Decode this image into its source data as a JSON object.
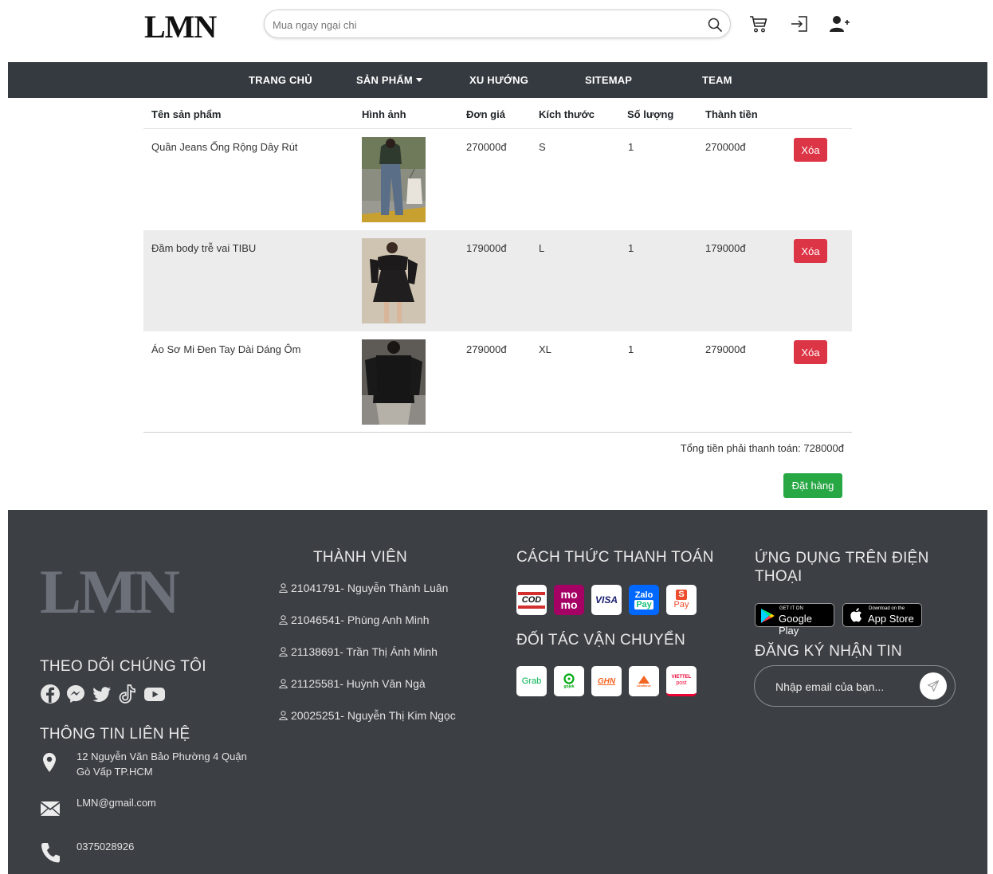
{
  "header": {
    "logo": "LMN",
    "search_placeholder": "Mua ngay ngại chi"
  },
  "nav": {
    "items": [
      "TRANG CHỦ",
      "SẢN PHẨM",
      "XU HƯỚNG",
      "SITEMAP",
      "TEAM"
    ]
  },
  "cart": {
    "columns": [
      "Tên sản phẩm",
      "Hình ảnh",
      "Đơn giá",
      "Kích thước",
      "Số lượng",
      "Thành tiền"
    ],
    "rows": [
      {
        "name": "Quần Jeans Ống Rộng Dây Rút",
        "price": "270000đ",
        "size": "S",
        "qty": "1",
        "subtotal": "270000đ",
        "delete": "Xóa"
      },
      {
        "name": "Đầm body trễ vai TIBU",
        "price": "179000đ",
        "size": "L",
        "qty": "1",
        "subtotal": "179000đ",
        "delete": "Xóa"
      },
      {
        "name": "Áo Sơ Mi Đen Tay Dài Dáng Ôm",
        "price": "279000đ",
        "size": "XL",
        "qty": "1",
        "subtotal": "279000đ",
        "delete": "Xóa"
      }
    ],
    "total": "Tổng tiền phải thanh toán: 728000đ",
    "order_button": "Đặt hàng"
  },
  "footer": {
    "logo": "LMN",
    "follow_title": "THEO DÕI CHÚNG TÔI",
    "social_icons": [
      "facebook-icon",
      "messenger-icon",
      "twitter-icon",
      "tiktok-icon",
      "youtube-icon"
    ],
    "contact_title": "THÔNG TIN LIÊN HỆ",
    "address": "12 Nguyễn Văn Bảo Phường 4 Quận Gò Vấp TP.HCM",
    "email": "LMN@gmail.com",
    "phone": "0375028926",
    "members_title": "THÀNH VIÊN",
    "members": [
      "21041791- Nguyễn Thành Luân",
      "21046541- Phùng Anh Minh",
      "21138691- Trần Thị Ánh Minh",
      "21125581- Huỳnh Văn Ngà",
      "20025251- Nguyễn Thị Kim Ngọc"
    ],
    "payment_title": "CÁCH THỨC THANH TOÁN",
    "payment_methods": {
      "cod": "COD",
      "momo_top": "mo",
      "momo_bottom": "mo",
      "visa": "VISA",
      "zalo_top": "Zalo",
      "zalo_bottom": "Pay",
      "shopee_top": "S",
      "shopee_bottom": "Pay"
    },
    "shipping_title": "ĐỐI TÁC VẬN CHUYỂN",
    "shipping_partners": {
      "grab": "Grab",
      "gojek": "gojek",
      "ghn": "GHN",
      "ahamove": "AhaMove",
      "viettel_top": "VIETTEL",
      "viettel_bottom": "post"
    },
    "app_title": "ỨNG DỤNG TRÊN ĐIỆN THOẠI",
    "google_play": {
      "small": "GET IT ON",
      "big": "Google Play"
    },
    "app_store": {
      "small": "Download on the",
      "big": "App Store"
    },
    "newsletter_title": "ĐĂNG KÝ NHẬN TIN",
    "newsletter_placeholder": "Nhập email của bạn..."
  }
}
